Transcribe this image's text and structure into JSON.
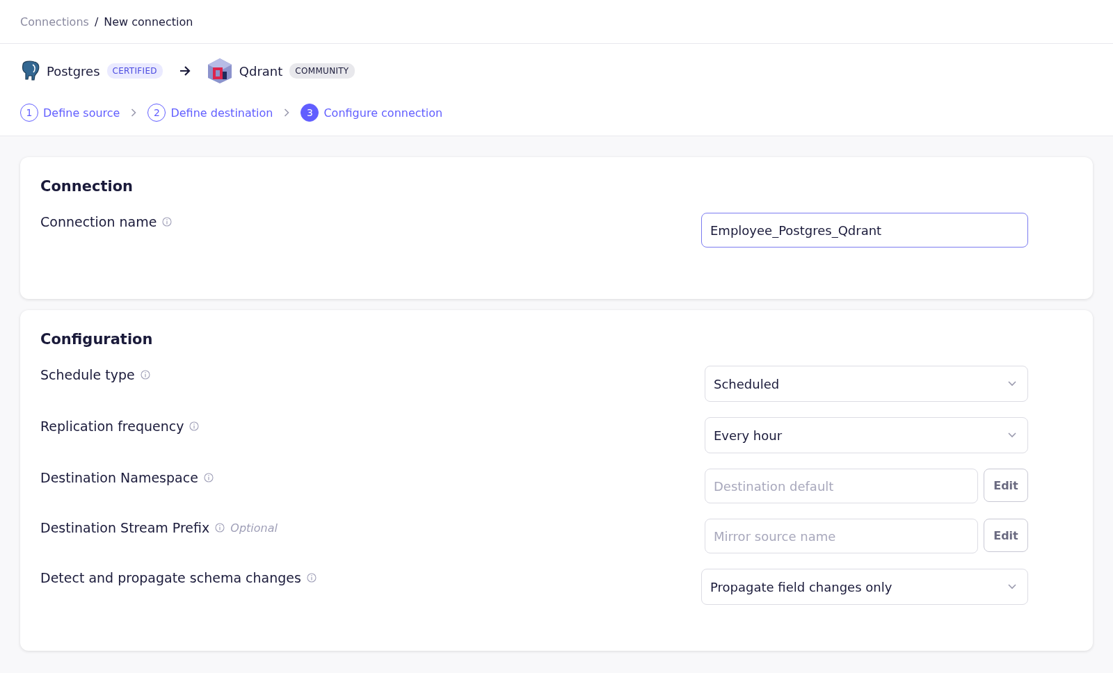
{
  "breadcrumb_separator": "/",
  "breadcrumb": [
    {
      "label": "Connections",
      "current": false
    },
    {
      "label": "New connection",
      "current": true
    }
  ],
  "source": {
    "name": "Postgres",
    "badge": "CERTIFIED"
  },
  "destination": {
    "name": "Qdrant",
    "badge": "COMMUNITY"
  },
  "steps": [
    {
      "number": "1",
      "label": "Define source",
      "selected": false
    },
    {
      "number": "2",
      "label": "Define destination",
      "selected": false
    },
    {
      "number": "3",
      "label": "Configure connection",
      "selected": true
    }
  ],
  "sections": [
    {
      "title": "Connection",
      "fields": [
        {
          "kind": "text",
          "label": "Connection name",
          "value": "Employee_Postgres_Qdrant",
          "focused": true
        }
      ]
    },
    {
      "title": "Configuration",
      "fields": [
        {
          "kind": "select",
          "label": "Schedule type",
          "value": "Scheduled"
        },
        {
          "kind": "select",
          "label": "Replication frequency",
          "value": "Every hour"
        },
        {
          "kind": "edit",
          "label": "Destination Namespace",
          "placeholder": "Destination default",
          "button": "Edit"
        },
        {
          "kind": "edit",
          "label": "Destination Stream Prefix",
          "note": "Optional",
          "placeholder": "Mirror source name",
          "button": "Edit"
        },
        {
          "kind": "select",
          "label": "Detect and propagate schema changes",
          "value": "Propagate field changes only",
          "wide": true
        }
      ]
    }
  ]
}
